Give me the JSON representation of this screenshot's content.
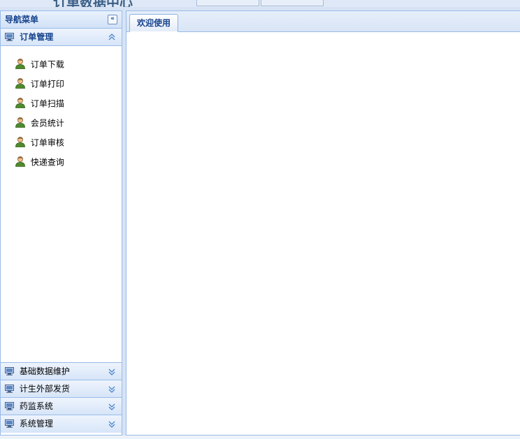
{
  "header": {
    "logo_text": "订单数据中心"
  },
  "nav": {
    "title": "导航菜单",
    "sections": [
      {
        "label": "订单管理",
        "expanded": true,
        "items": [
          "订单下载",
          "订单打印",
          "订单扫描",
          "会员统计",
          "订单审核",
          "快递查询"
        ]
      },
      {
        "label": "基础数据维护",
        "expanded": false
      },
      {
        "label": "计生外部发货",
        "expanded": false
      },
      {
        "label": "药监系统",
        "expanded": false
      },
      {
        "label": "系统管理",
        "expanded": false
      }
    ]
  },
  "tabs": [
    {
      "label": "欢迎使用",
      "active": true
    }
  ],
  "colors": {
    "border": "#99bbe8",
    "header_text": "#15428b",
    "background": "#d7e3f4"
  },
  "icons": {
    "section": "monitor-icon",
    "item": "user-icon",
    "expanded": "chevron-up-icon",
    "collapsed": "chevron-down-icon",
    "collapse_panel": "double-chevron-left-icon"
  }
}
